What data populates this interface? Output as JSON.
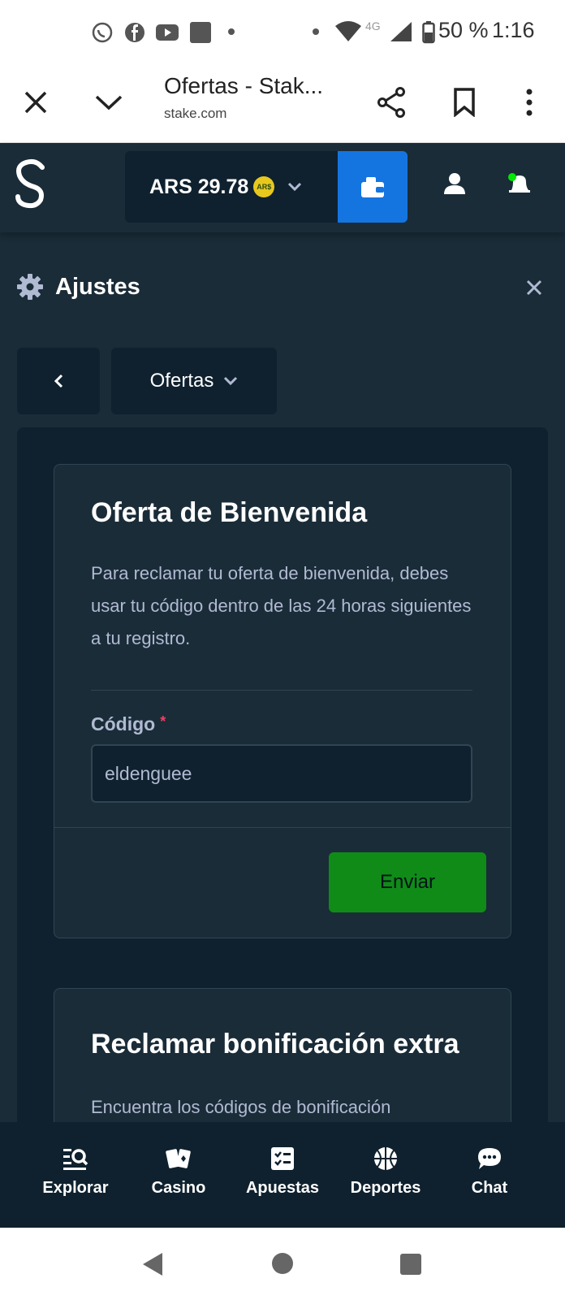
{
  "status_bar": {
    "battery": "50 %",
    "time": "1:16",
    "network": "4G"
  },
  "browser": {
    "title": "Ofertas - Stak...",
    "url": "stake.com"
  },
  "header": {
    "balance": "ARS 29.78",
    "currency_badge": "AR$",
    "accent_color": "#1475e1"
  },
  "settings": {
    "title": "Ajustes",
    "section_dropdown": "Ofertas"
  },
  "welcome_offer": {
    "title": "Oferta de Bienvenida",
    "description": "Para reclamar tu oferta de bienvenida, debes usar tu código dentro de las 24 horas siguientes a tu registro.",
    "code_label": "Código",
    "required_mark": "*",
    "code_value": "eldenguee",
    "submit_label": "Enviar",
    "submit_color": "#108b18"
  },
  "extra_bonus": {
    "title": "Reclamar bonificación extra",
    "description": "Encuentra los códigos de bonificación"
  },
  "bottom_nav": {
    "items": [
      {
        "label": "Explorar",
        "icon": "search-list-icon"
      },
      {
        "label": "Casino",
        "icon": "cards-icon"
      },
      {
        "label": "Apuestas",
        "icon": "checklist-icon"
      },
      {
        "label": "Deportes",
        "icon": "basketball-icon"
      },
      {
        "label": "Chat",
        "icon": "chat-bubble-icon"
      }
    ]
  }
}
